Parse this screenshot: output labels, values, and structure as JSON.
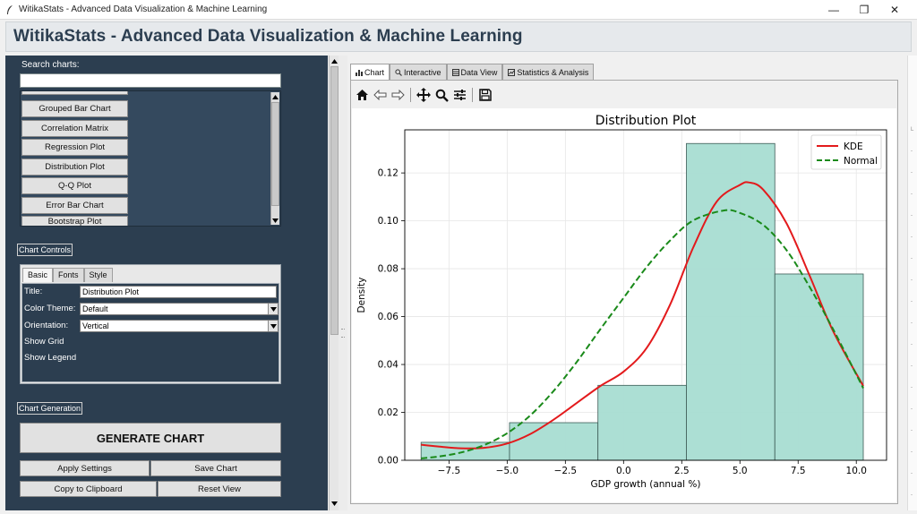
{
  "window": {
    "title": "WitikaStats - Advanced Data Visualization & Machine Learning",
    "minimize": "—",
    "maximize": "❐",
    "close": "✕"
  },
  "app": {
    "header": "WitikaStats - Advanced Data Visualization & Machine Learning"
  },
  "left": {
    "search_label": "Search charts:",
    "search_value": "",
    "chart_list": [
      "Grouped Bar Chart",
      "Correlation Matrix",
      "Regression Plot",
      "Distribution Plot",
      "Q-Q Plot",
      "Error Bar Chart",
      "Bootstrap Plot"
    ],
    "chart_controls_label": "Chart Controls",
    "tabs": [
      "Basic",
      "Fonts",
      "Style"
    ],
    "controls": {
      "title_label": "Title:",
      "title_value": "Distribution Plot",
      "color_theme_label": "Color Theme:",
      "color_theme_value": "Default",
      "orientation_label": "Orientation:",
      "orientation_value": "Vertical",
      "show_grid_label": "Show Grid",
      "show_legend_label": "Show Legend"
    },
    "chart_generation_label": "Chart Generation",
    "generate_button": "GENERATE CHART",
    "apply_settings": "Apply Settings",
    "save_chart": "Save Chart",
    "copy_clipboard": "Copy to Clipboard",
    "reset_view": "Reset View"
  },
  "right": {
    "tabs": [
      "Chart",
      "Interactive",
      "Data View",
      "Statistics & Analysis"
    ],
    "toolbar_icons": [
      "home-icon",
      "back-arrow-icon",
      "forward-arrow-icon",
      "pan-icon",
      "zoom-icon",
      "configure-icon",
      "save-icon"
    ]
  },
  "sliver_text": [
    "L",
    "-",
    "-",
    "-",
    "-",
    "-",
    "-",
    "-",
    "-",
    "-",
    "-",
    "-",
    "-",
    "-",
    "-",
    "-",
    "-",
    "-"
  ],
  "colors": {
    "panel": "#2c3e50",
    "hist_fill": "#a8ddd2",
    "kde": "#e31a1c",
    "normal": "#1a8a1a"
  },
  "chart_data": {
    "type": "bar",
    "title": "Distribution Plot",
    "xlabel": "GDP growth (annual %)",
    "ylabel": "Density",
    "xlim": [
      -9.4,
      11.3
    ],
    "ylim": [
      0,
      0.138
    ],
    "xticks": [
      -7.5,
      -5.0,
      -2.5,
      0.0,
      2.5,
      5.0,
      7.5,
      10.0
    ],
    "xtick_labels": [
      "−7.5",
      "−5.0",
      "−2.5",
      "0.0",
      "2.5",
      "5.0",
      "7.5",
      "10.0"
    ],
    "yticks": [
      0.0,
      0.02,
      0.04,
      0.06,
      0.08,
      0.1,
      0.12
    ],
    "ytick_labels": [
      "0.00",
      "0.02",
      "0.04",
      "0.06",
      "0.08",
      "0.10",
      "0.12"
    ],
    "grid": true,
    "legend": "top-right",
    "histogram": {
      "bin_edges": [
        -8.7,
        -4.9,
        -1.1,
        2.7,
        6.5,
        10.3
      ],
      "densities": [
        0.0075,
        0.0157,
        0.0313,
        0.1323,
        0.0778
      ]
    },
    "series": [
      {
        "name": "KDE",
        "style": "solid",
        "x": [
          -8.7,
          -8.0,
          -7.0,
          -6.0,
          -5.0,
          -4.0,
          -3.0,
          -2.0,
          -1.0,
          0.0,
          1.0,
          2.0,
          3.0,
          4.0,
          5.0,
          5.4,
          6.0,
          7.0,
          8.0,
          9.0,
          10.3
        ],
        "y": [
          0.0065,
          0.0058,
          0.005,
          0.0052,
          0.007,
          0.011,
          0.017,
          0.024,
          0.031,
          0.037,
          0.047,
          0.065,
          0.089,
          0.108,
          0.115,
          0.116,
          0.113,
          0.099,
          0.077,
          0.054,
          0.031
        ]
      },
      {
        "name": "Normal",
        "style": "dashed",
        "x": [
          -8.7,
          -8.0,
          -7.0,
          -6.0,
          -5.0,
          -4.0,
          -3.0,
          -2.0,
          -1.0,
          0.0,
          1.0,
          2.0,
          3.0,
          4.3,
          5.0,
          6.0,
          7.0,
          8.0,
          9.0,
          10.3
        ],
        "y": [
          0.0008,
          0.0015,
          0.0032,
          0.0063,
          0.0113,
          0.0188,
          0.029,
          0.0412,
          0.0547,
          0.0678,
          0.0808,
          0.0918,
          0.1002,
          0.1043,
          0.1033,
          0.0983,
          0.0878,
          0.0723,
          0.0548,
          0.0301
        ]
      }
    ]
  }
}
